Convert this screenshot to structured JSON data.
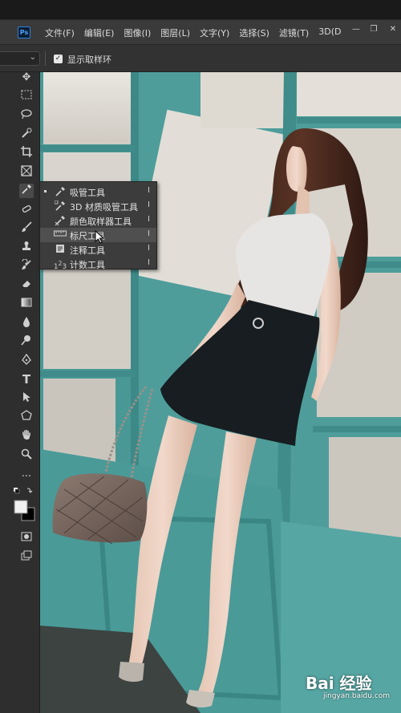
{
  "app": {
    "logo": "Ps"
  },
  "menubar": {
    "items": [
      "文件(F)",
      "编辑(E)",
      "图像(I)",
      "图层(L)",
      "文字(Y)",
      "选择(S)",
      "滤镜(T)",
      "3D(D"
    ]
  },
  "window_controls": {
    "minimize": "—",
    "restore": "❐",
    "close": "✕"
  },
  "options_bar": {
    "checkbox_label": "显示取样环",
    "checkbox_checked": true
  },
  "toolbar": {
    "tools": [
      "move-icon",
      "marquee-icon",
      "lasso-icon",
      "quick-select-icon",
      "crop-icon",
      "frame-icon",
      "eyedropper-icon",
      "healing-icon",
      "brush-icon",
      "stamp-icon",
      "history-brush-icon",
      "eraser-icon",
      "gradient-icon",
      "blur-icon",
      "dodge-icon",
      "pen-icon",
      "type-icon",
      "path-select-icon",
      "shape-icon",
      "hand-icon",
      "zoom-icon",
      "more-icon",
      "swap-colors-icon",
      "color-swatch-icon",
      "quick-mask-icon",
      "screen-mode-icon"
    ]
  },
  "flyout": {
    "items": [
      {
        "label": "吸管工具",
        "key": "I",
        "icon": "eyedropper-icon",
        "active": true,
        "highlighted": false
      },
      {
        "label": "3D 材质吸管工具",
        "key": "I",
        "icon": "3d-material-eyedropper-icon",
        "active": false,
        "highlighted": false
      },
      {
        "label": "颜色取样器工具",
        "key": "I",
        "icon": "color-sampler-icon",
        "active": false,
        "highlighted": false
      },
      {
        "label": "标尺工具",
        "key": "I",
        "icon": "ruler-icon",
        "active": false,
        "highlighted": true
      },
      {
        "label": "注释工具",
        "key": "I",
        "icon": "note-icon",
        "active": false,
        "highlighted": false
      },
      {
        "label": "计数工具",
        "key": "I",
        "icon": "count-icon",
        "active": false,
        "highlighted": false
      }
    ]
  },
  "watermark": {
    "main": "Bai 经验",
    "sub": "jingyan.baidu.com"
  },
  "colors": {
    "canvas_bg": "#4a9a98",
    "panel": "#323232",
    "menubar": "#3a3a3a"
  }
}
